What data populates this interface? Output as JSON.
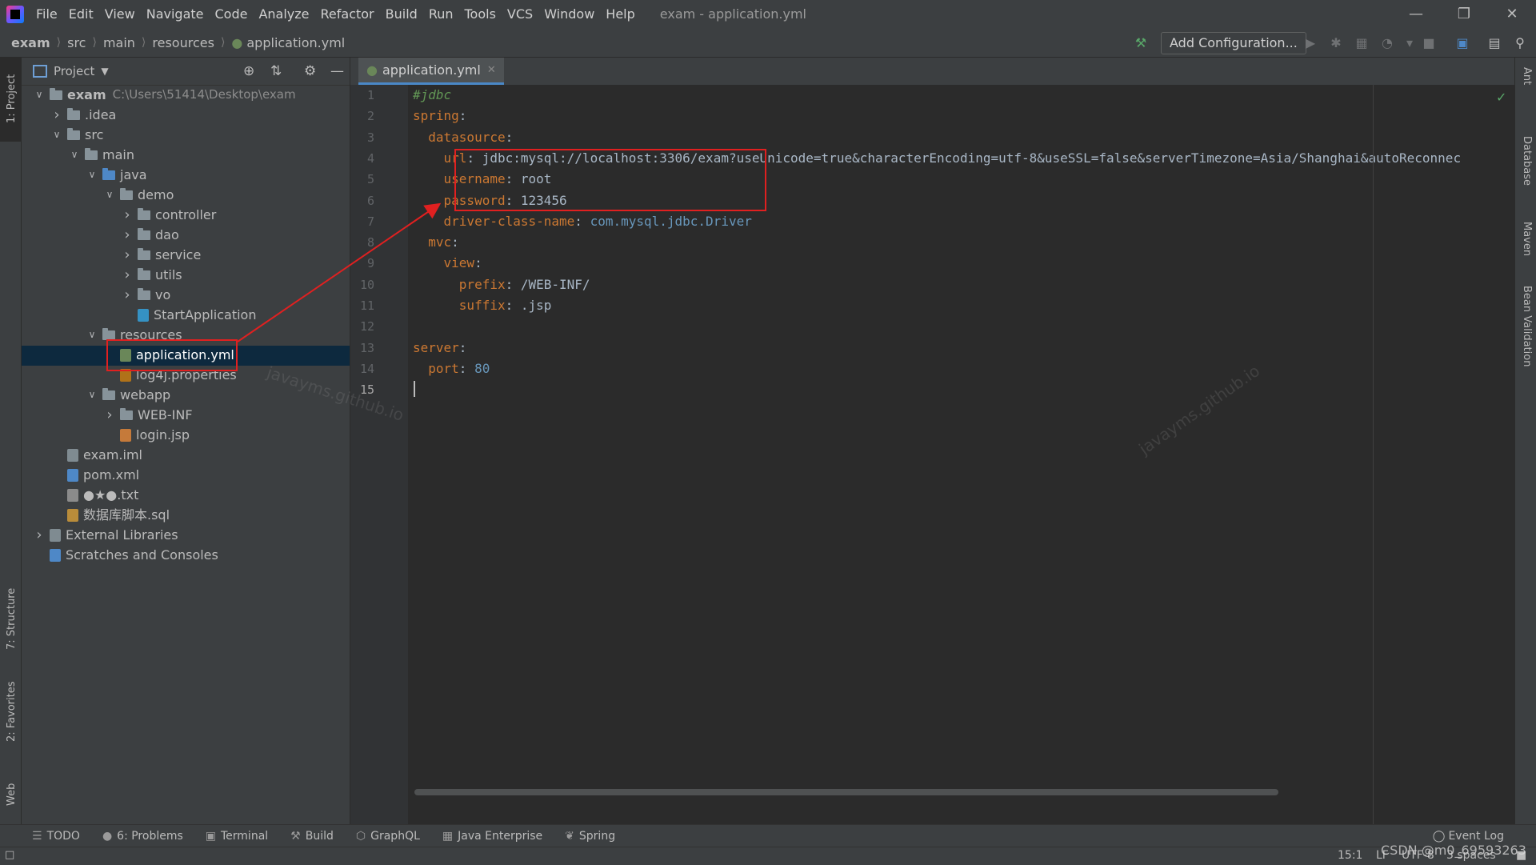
{
  "menu": {
    "items": [
      "File",
      "Edit",
      "View",
      "Navigate",
      "Code",
      "Analyze",
      "Refactor",
      "Build",
      "Run",
      "Tools",
      "VCS",
      "Window",
      "Help"
    ],
    "window_title": "exam - application.yml"
  },
  "breadcrumb": [
    "exam",
    "src",
    "main",
    "resources",
    "application.yml"
  ],
  "toolbar": {
    "add_configuration": "Add Configuration..."
  },
  "project_panel": {
    "title": "Project",
    "tree": [
      {
        "label": "exam",
        "path": "C:\\Users\\51414\\Desktop\\exam",
        "depth": 0,
        "expanded": true,
        "icon": "folder-icon"
      },
      {
        "label": ".idea",
        "depth": 1,
        "expanded": false,
        "icon": "folder-icon"
      },
      {
        "label": "src",
        "depth": 1,
        "expanded": true,
        "icon": "folder-icon"
      },
      {
        "label": "main",
        "depth": 2,
        "expanded": true,
        "icon": "folder-icon"
      },
      {
        "label": "java",
        "depth": 3,
        "expanded": true,
        "icon": "source-folder-icon"
      },
      {
        "label": "demo",
        "depth": 4,
        "expanded": true,
        "icon": "package-icon"
      },
      {
        "label": "controller",
        "depth": 5,
        "expanded": false,
        "icon": "package-icon"
      },
      {
        "label": "dao",
        "depth": 5,
        "expanded": false,
        "icon": "package-icon"
      },
      {
        "label": "service",
        "depth": 5,
        "expanded": false,
        "icon": "package-icon"
      },
      {
        "label": "utils",
        "depth": 5,
        "expanded": false,
        "icon": "package-icon"
      },
      {
        "label": "vo",
        "depth": 5,
        "expanded": false,
        "icon": "package-icon"
      },
      {
        "label": "StartApplication",
        "depth": 5,
        "icon": "spring-boot-class-icon"
      },
      {
        "label": "resources",
        "depth": 3,
        "expanded": true,
        "icon": "resources-folder-icon"
      },
      {
        "label": "application.yml",
        "depth": 4,
        "selected": true,
        "icon": "yaml-file-icon"
      },
      {
        "label": "log4j.properties",
        "depth": 4,
        "icon": "properties-file-icon"
      },
      {
        "label": "webapp",
        "depth": 3,
        "expanded": true,
        "icon": "folder-icon"
      },
      {
        "label": "WEB-INF",
        "depth": 4,
        "expanded": false,
        "icon": "folder-icon"
      },
      {
        "label": "login.jsp",
        "depth": 4,
        "icon": "jsp-file-icon"
      },
      {
        "label": "exam.iml",
        "depth": 1,
        "icon": "iml-file-icon"
      },
      {
        "label": "pom.xml",
        "depth": 1,
        "icon": "maven-file-icon"
      },
      {
        "label": "●★●.txt",
        "depth": 1,
        "icon": "text-file-icon"
      },
      {
        "label": "数据库脚本.sql",
        "depth": 1,
        "icon": "sql-file-icon"
      },
      {
        "label": "External Libraries",
        "depth": 0,
        "expanded": false,
        "icon": "library-icon"
      },
      {
        "label": "Scratches and Consoles",
        "depth": 0,
        "icon": "scratches-icon"
      }
    ]
  },
  "editor": {
    "tab_label": "application.yml",
    "line_numbers": [
      "1",
      "2",
      "3",
      "4",
      "5",
      "6",
      "7",
      "8",
      "9",
      "10",
      "11",
      "12",
      "13",
      "14",
      "15"
    ],
    "lines": [
      {
        "parts": [
          {
            "t": "#jdbc",
            "c": "cm"
          }
        ]
      },
      {
        "parts": [
          {
            "t": "spring",
            "c": "k"
          },
          {
            "t": ":",
            "c": "v"
          }
        ]
      },
      {
        "parts": [
          {
            "t": "  datasource",
            "c": "k"
          },
          {
            "t": ":",
            "c": "v"
          }
        ]
      },
      {
        "parts": [
          {
            "t": "    url",
            "c": "k"
          },
          {
            "t": ": jdbc:mysql://localhost:3306/exam?useUnicode=true&characterEncoding=utf-8&useSSL=false&serverTimezone=Asia/Shanghai&autoReconnec",
            "c": "v"
          }
        ]
      },
      {
        "parts": [
          {
            "t": "    username",
            "c": "k"
          },
          {
            "t": ": root",
            "c": "v"
          }
        ]
      },
      {
        "parts": [
          {
            "t": "    password",
            "c": "k"
          },
          {
            "t": ": 123456",
            "c": "v"
          }
        ]
      },
      {
        "parts": [
          {
            "t": "    driver-class-name",
            "c": "k"
          },
          {
            "t": ": ",
            "c": "v"
          },
          {
            "t": "com.mysql.jdbc.Driver",
            "c": "n"
          }
        ]
      },
      {
        "parts": [
          {
            "t": "  mvc",
            "c": "k"
          },
          {
            "t": ":",
            "c": "v"
          }
        ]
      },
      {
        "parts": [
          {
            "t": "    view",
            "c": "k"
          },
          {
            "t": ":",
            "c": "v"
          }
        ]
      },
      {
        "parts": [
          {
            "t": "      prefix",
            "c": "k"
          },
          {
            "t": ": /WEB-INF/",
            "c": "v"
          }
        ]
      },
      {
        "parts": [
          {
            "t": "      suffix",
            "c": "k"
          },
          {
            "t": ": .jsp",
            "c": "v"
          }
        ]
      },
      {
        "parts": []
      },
      {
        "parts": [
          {
            "t": "server",
            "c": "k"
          },
          {
            "t": ":",
            "c": "v"
          }
        ]
      },
      {
        "parts": [
          {
            "t": "  port",
            "c": "k"
          },
          {
            "t": ": ",
            "c": "v"
          },
          {
            "t": "80",
            "c": "n"
          }
        ]
      },
      {
        "parts": []
      }
    ]
  },
  "left_stripe": {
    "project": "1: Project",
    "structure": "7: Structure",
    "favorites": "2: Favorites",
    "web": "Web"
  },
  "right_stripe": {
    "ant": "Ant",
    "database": "Database",
    "maven": "Maven",
    "bean_validation": "Bean Validation"
  },
  "tool_windows": [
    {
      "label": "TODO",
      "icon": "list-icon"
    },
    {
      "label": "6: Problems",
      "icon": "problems-icon"
    },
    {
      "label": "Terminal",
      "icon": "terminal-icon"
    },
    {
      "label": "Build",
      "icon": "hammer-icon"
    },
    {
      "label": "GraphQL",
      "icon": "graphql-icon"
    },
    {
      "label": "Java Enterprise",
      "icon": "java-enterprise-icon"
    },
    {
      "label": "Spring",
      "icon": "spring-icon"
    }
  ],
  "event_log": "Event Log",
  "status": {
    "position": "15:1",
    "line_sep": "LF",
    "encoding": "UTF-8",
    "indent": "3 spaces"
  },
  "watermarks": {
    "w1": "javayms.github.io",
    "w2": "javayms.github.io",
    "csdn": "CSDN @m0_69593263"
  },
  "colors": {
    "accent": "#4a88c7",
    "keyword": "#cc7832",
    "comment": "#629755",
    "number": "#6897bb",
    "annotation": "#e02020"
  }
}
